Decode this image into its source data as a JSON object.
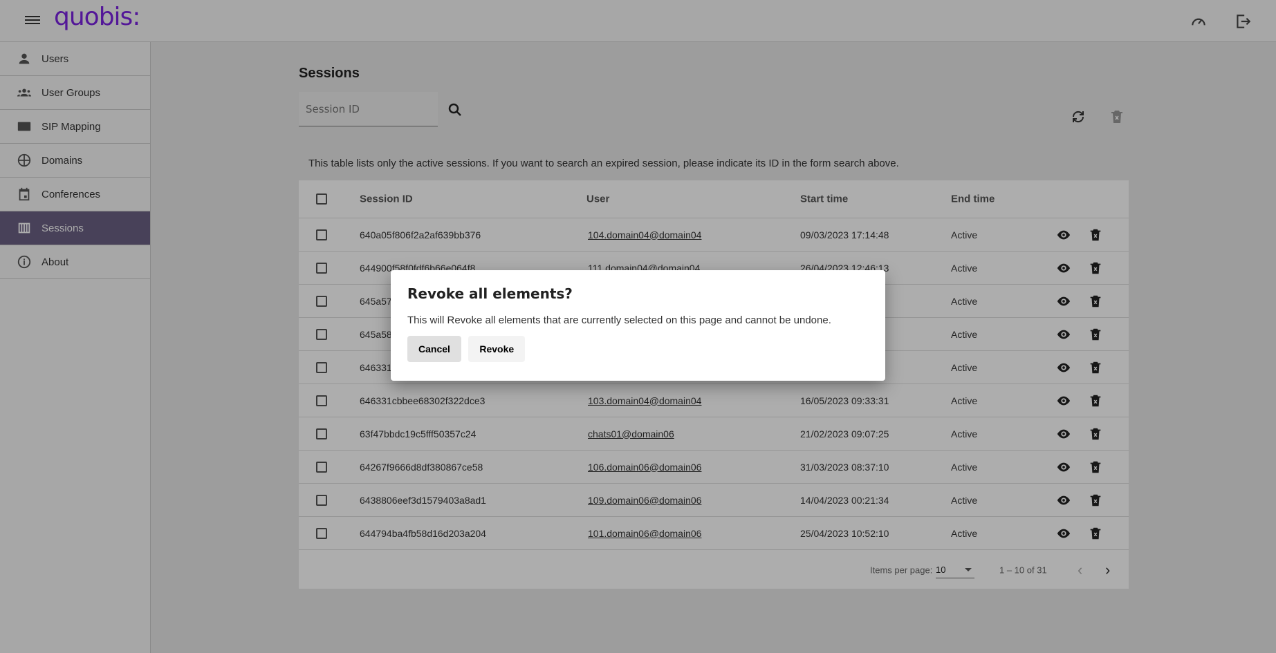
{
  "header": {
    "logo": "quobis:",
    "icons": [
      "menu-icon",
      "dashboard-icon",
      "logout-icon"
    ]
  },
  "sidebar": {
    "items": [
      {
        "label": "Users",
        "icon": "person-icon"
      },
      {
        "label": "User Groups",
        "icon": "groups-icon"
      },
      {
        "label": "SIP Mapping",
        "icon": "pin-123-icon"
      },
      {
        "label": "Domains",
        "icon": "globe-icon"
      },
      {
        "label": "Conferences",
        "icon": "calendar-icon"
      },
      {
        "label": "Sessions",
        "icon": "view-column-icon",
        "active": true
      },
      {
        "label": "About",
        "icon": "info-icon"
      }
    ]
  },
  "main": {
    "title": "Sessions",
    "search": {
      "placeholder": "Session ID",
      "value": ""
    },
    "info": "This table lists only the active sessions. If you want to search an expired session, please indicate its ID in the form search above.",
    "columns": [
      "Session ID",
      "User",
      "Start time",
      "End time"
    ],
    "rows": [
      {
        "id": "640a05f806f2a2af639bb376",
        "user": "104.domain04@domain04",
        "start": "09/03/2023 17:14:48",
        "end": "Active"
      },
      {
        "id": "644900f58f0fdf6b66e064f8",
        "user": "111.domain04@domain04",
        "start": "26/04/2023 12:46:13",
        "end": "Active"
      },
      {
        "id": "645a57",
        "user": "",
        "start": "",
        "end": "Active"
      },
      {
        "id": "645a58",
        "user": "",
        "start": "",
        "end": "Active"
      },
      {
        "id": "646331",
        "user": "",
        "start": "",
        "end": "Active"
      },
      {
        "id": "646331cbbee68302f322dce3",
        "user": "103.domain04@domain04",
        "start": "16/05/2023 09:33:31",
        "end": "Active"
      },
      {
        "id": "63f47bbdc19c5fff50357c24",
        "user": "chats01@domain06",
        "start": "21/02/2023 09:07:25",
        "end": "Active"
      },
      {
        "id": "64267f9666d8df380867ce58",
        "user": "106.domain06@domain06",
        "start": "31/03/2023 08:37:10",
        "end": "Active"
      },
      {
        "id": "6438806eef3d1579403a8ad1",
        "user": "109.domain06@domain06",
        "start": "14/04/2023 00:21:34",
        "end": "Active"
      },
      {
        "id": "644794ba4fb58d16d203a204",
        "user": "101.domain06@domain06",
        "start": "25/04/2023 10:52:10",
        "end": "Active"
      }
    ],
    "paginator": {
      "label": "Items per page:",
      "page_size": "10",
      "range": "1 – 10 of 31"
    }
  },
  "dialog": {
    "title": "Revoke all elements?",
    "message": "This will Revoke all elements that are currently selected on this page and cannot be undone.",
    "cancel": "Cancel",
    "confirm": "Revoke"
  }
}
